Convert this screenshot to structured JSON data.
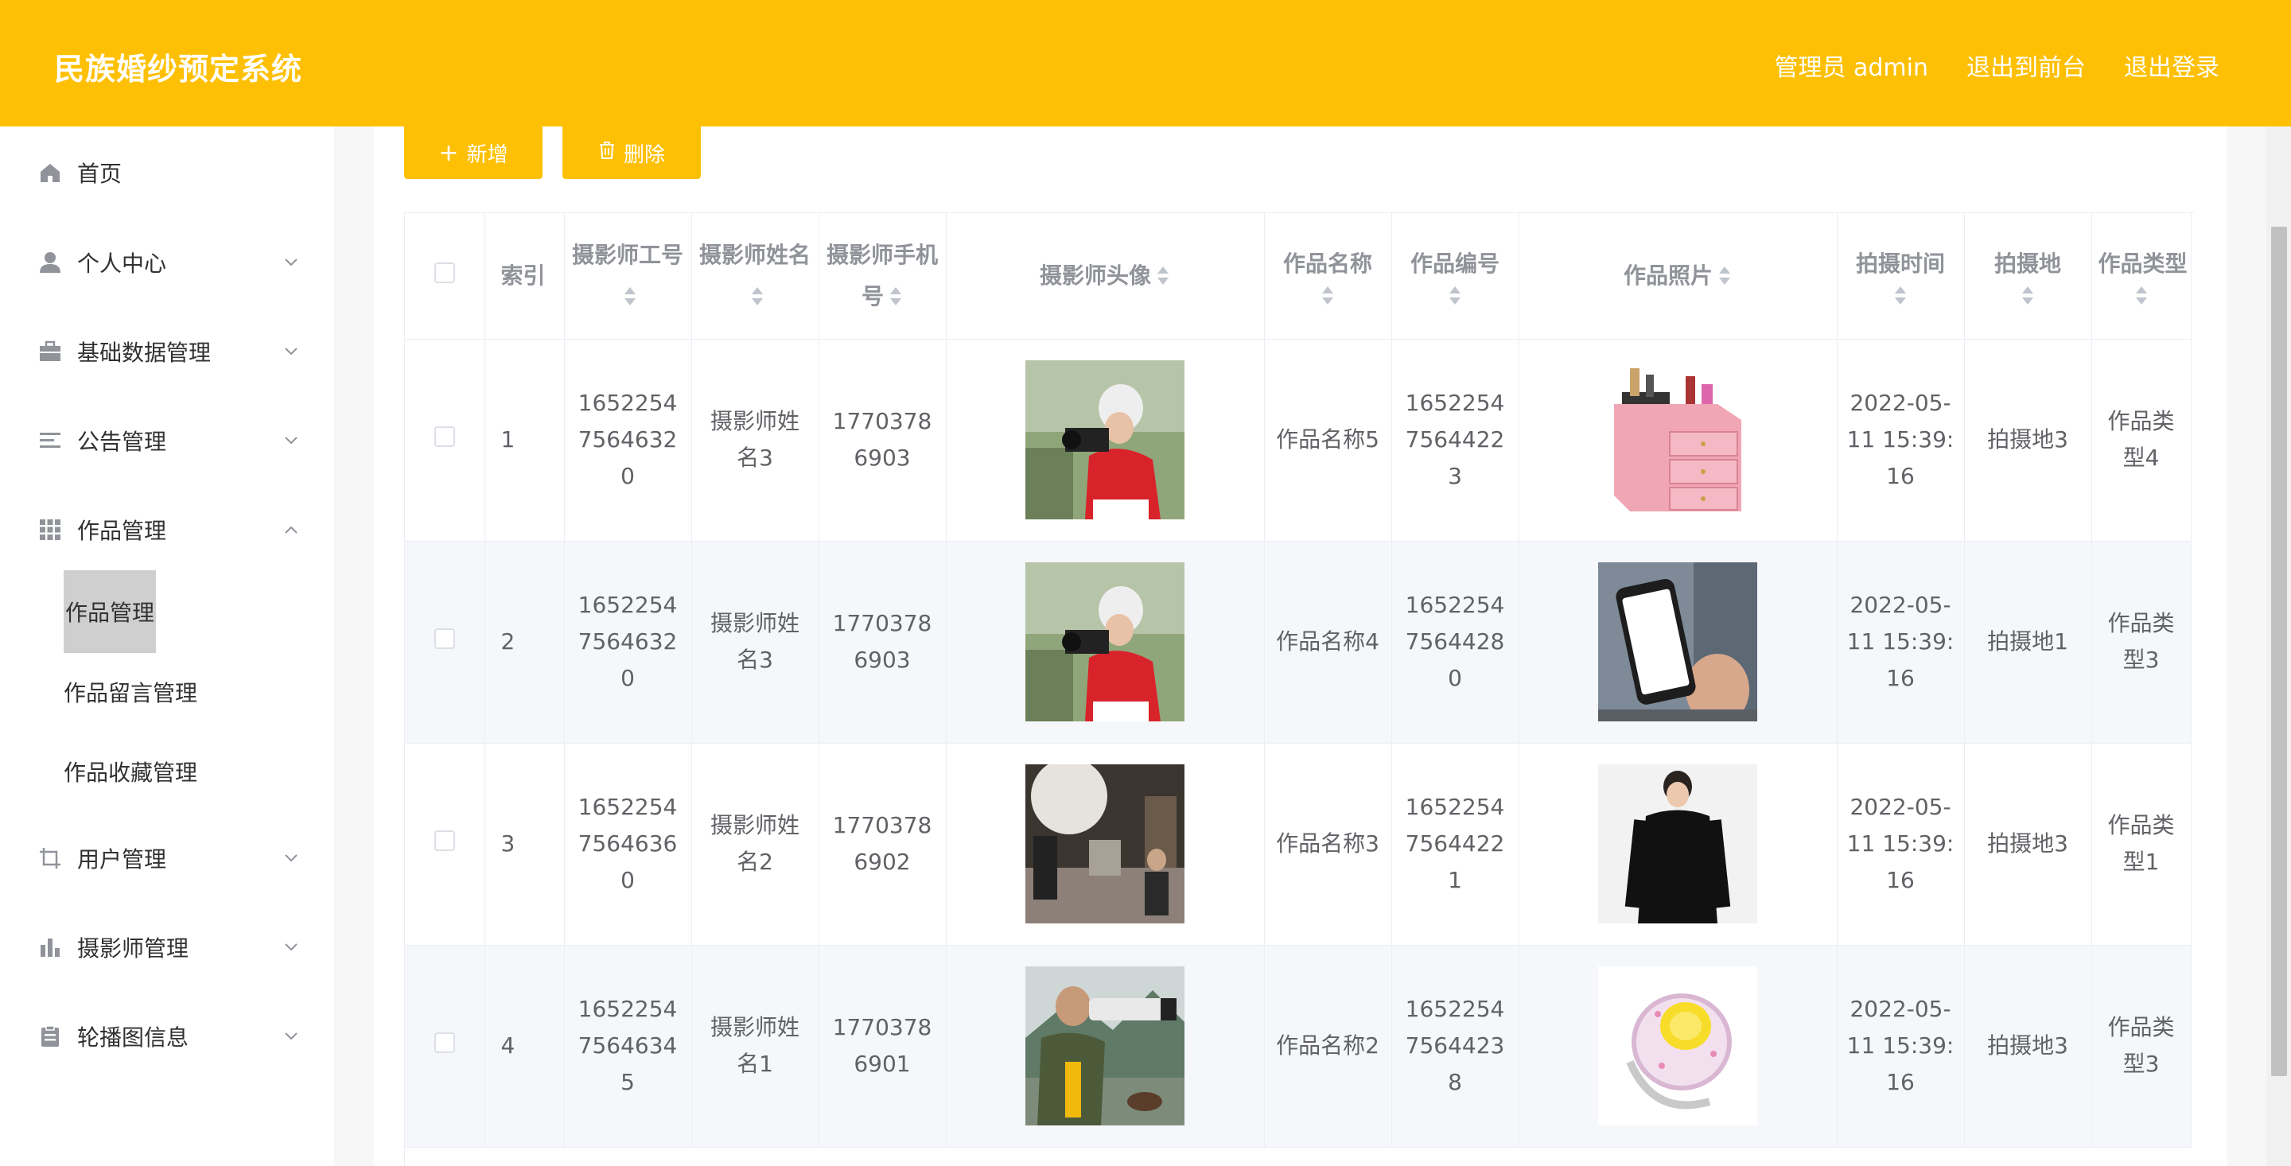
{
  "header": {
    "title": "民族婚纱预定系统",
    "admin_label": "管理员 admin",
    "front_link": "退出到前台",
    "logout_link": "退出登录"
  },
  "sidebar": {
    "items": [
      {
        "label": "首页",
        "icon": "home-icon"
      },
      {
        "label": "个人中心",
        "icon": "user-icon"
      },
      {
        "label": "基础数据管理",
        "icon": "briefcase-icon"
      },
      {
        "label": "公告管理",
        "icon": "list-icon"
      },
      {
        "label": "作品管理",
        "icon": "grid-icon"
      },
      {
        "label": "用户管理",
        "icon": "crop-icon"
      },
      {
        "label": "摄影师管理",
        "icon": "bar-chart-icon"
      },
      {
        "label": "轮播图信息",
        "icon": "clipboard-icon"
      }
    ],
    "sub_items": [
      "作品管理",
      "作品留言管理",
      "作品收藏管理"
    ]
  },
  "toolbar": {
    "add_label": "新增",
    "delete_label": "删除"
  },
  "table": {
    "headers": {
      "index": "索引",
      "photographer_no": "摄影师工号",
      "photographer_name": "摄影师姓名",
      "photographer_phone": "摄影师手机号",
      "photographer_avatar": "摄影师头像",
      "work_name": "作品名称",
      "work_no": "作品编号",
      "work_photo": "作品照片",
      "shoot_time": "拍摄时间",
      "shoot_place": "拍摄地",
      "work_type": "作品类型"
    },
    "rows": [
      {
        "index": "1",
        "photographer_no": "16522547564632 0",
        "photographer_name": "摄影师姓名3",
        "phone": "17703786903",
        "avatar": "photographer-woman-camera",
        "work_name": "作品名称5",
        "work_no": "16522547564422 3",
        "photo": "pink-cosmetic-box",
        "time": "2022-05-11 15:39:16",
        "place": "拍摄地3",
        "type": "作品类型4"
      },
      {
        "index": "2",
        "photographer_no": "16522547564632 0",
        "photographer_name": "摄影师姓名3",
        "phone": "17703786903",
        "avatar": "photographer-woman-camera",
        "work_name": "作品名称4",
        "work_no": "16522547564428 0",
        "photo": "smartphone-hand",
        "time": "2022-05-11 15:39:16",
        "place": "拍摄地1",
        "type": "作品类型3"
      },
      {
        "index": "3",
        "photographer_no": "16522547564636 0",
        "photographer_name": "摄影师姓名2",
        "phone": "17703786902",
        "avatar": "photo-studio",
        "work_name": "作品名称3",
        "work_no": "16522547564422 1",
        "photo": "man-black-sweater",
        "time": "2022-05-11 15:39:16",
        "place": "拍摄地3",
        "type": "作品类型1"
      },
      {
        "index": "4",
        "photographer_no": "16522547564634 5",
        "photographer_name": "摄影师姓名1",
        "phone": "17703786901",
        "avatar": "man-camera-outdoor",
        "work_name": "作品名称2",
        "work_no": "16522547564423 8",
        "photo": "yellow-gem-ring",
        "time": "2022-05-11 15:39:16",
        "place": "拍摄地3",
        "type": "作品类型3"
      }
    ]
  },
  "colors": {
    "accent": "#fec004",
    "header_text": "#ffffff",
    "stripe": "#f5f7fa"
  }
}
